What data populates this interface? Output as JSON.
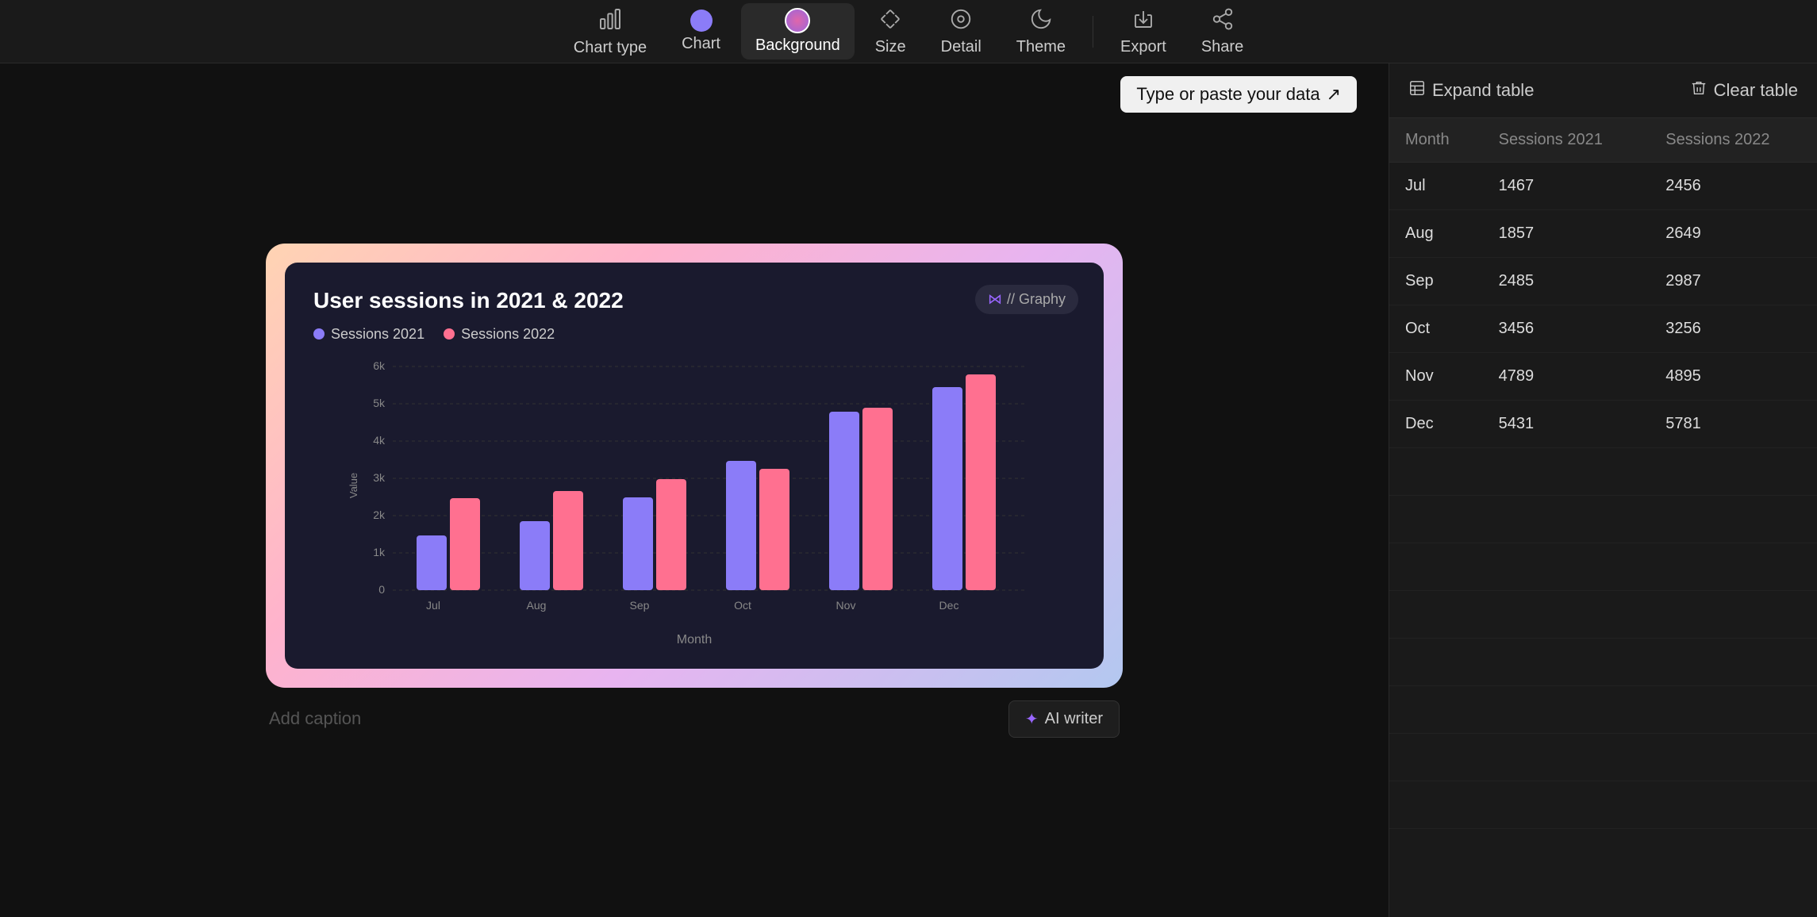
{
  "toolbar": {
    "items": [
      {
        "id": "chart-type",
        "label": "Chart type",
        "icon": "▦",
        "active": false
      },
      {
        "id": "chart",
        "label": "Chart",
        "icon": "dot",
        "active": false
      },
      {
        "id": "background",
        "label": "Background",
        "icon": "dot-active",
        "active": true
      },
      {
        "id": "size",
        "label": "Size",
        "icon": "✏️",
        "active": false
      },
      {
        "id": "detail",
        "label": "Detail",
        "icon": "◎",
        "active": false
      },
      {
        "id": "theme",
        "label": "Theme",
        "icon": "🌙",
        "active": false
      }
    ],
    "export_label": "Export",
    "share_label": "Share"
  },
  "canvas": {
    "type_paste_label": "Type or paste your data",
    "type_paste_arrow": "↗"
  },
  "chart": {
    "title": "User sessions in 2021 & 2022",
    "logo": "// Graphy",
    "legend": [
      {
        "id": "sessions2021",
        "label": "Sessions 2021",
        "color": "#8b7cf8"
      },
      {
        "id": "sessions2022",
        "label": "Sessions 2022",
        "color": "#ff7090"
      }
    ],
    "x_axis_label": "Month",
    "y_axis_label": "Value",
    "months": [
      "Jul",
      "Aug",
      "Sep",
      "Oct",
      "Nov",
      "Dec"
    ],
    "sessions_2021": [
      1467,
      1857,
      2485,
      3456,
      4789,
      5431
    ],
    "sessions_2022": [
      2456,
      2649,
      2987,
      3256,
      4895,
      5781
    ],
    "y_ticks": [
      "0",
      "1k",
      "2k",
      "3k",
      "4k",
      "5k",
      "6k"
    ],
    "max_value": 6000
  },
  "caption": {
    "placeholder": "Add caption",
    "ai_writer_label": "AI writer",
    "ai_writer_icon": "✦"
  },
  "right_panel": {
    "expand_table_label": "Expand table",
    "clear_table_label": "Clear table",
    "table": {
      "headers": [
        "Month",
        "Sessions 2021",
        "Sessions 2022"
      ],
      "rows": [
        {
          "month": "Jul",
          "s2021": "1467",
          "s2022": "2456"
        },
        {
          "month": "Aug",
          "s2021": "1857",
          "s2022": "2649"
        },
        {
          "month": "Sep",
          "s2021": "2485",
          "s2022": "2987"
        },
        {
          "month": "Oct",
          "s2021": "3456",
          "s2022": "3256"
        },
        {
          "month": "Nov",
          "s2021": "4789",
          "s2022": "4895"
        },
        {
          "month": "Dec",
          "s2021": "5431",
          "s2022": "5781"
        }
      ]
    }
  }
}
